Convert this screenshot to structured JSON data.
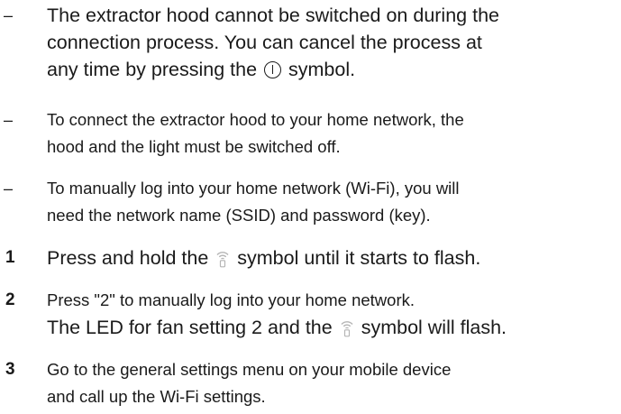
{
  "notes": [
    {
      "marker": "–",
      "lines": [
        "The extractor hood cannot be switched on during the",
        "connection process. You can cancel the process at",
        "any time by pressing the",
        "symbol."
      ]
    },
    {
      "marker": "–",
      "lines": [
        "To connect the extractor hood to your home network, the",
        "hood and the light must be switched off."
      ]
    },
    {
      "marker": "–",
      "lines": [
        "To manually log into your home network (Wi-Fi), you will",
        "need the network name (SSID) and password (key)."
      ]
    }
  ],
  "steps": [
    {
      "number": "1",
      "lines": [
        "Press and hold the",
        "symbol until it starts to flash."
      ]
    },
    {
      "number": "2",
      "lines": [
        "Press \"2\" to manually log into your home network.",
        "The LED for fan setting 2 and the",
        "symbol will flash."
      ]
    },
    {
      "number": "3",
      "lines": [
        "Go to the general settings menu on your mobile device",
        "and call up the Wi-Fi settings."
      ]
    }
  ],
  "icons": {
    "power": "power-symbol",
    "wifi": "wifi-symbol",
    "icon_color": "#1a1a1a",
    "wifi_icon_color": "#b5b5b5"
  }
}
